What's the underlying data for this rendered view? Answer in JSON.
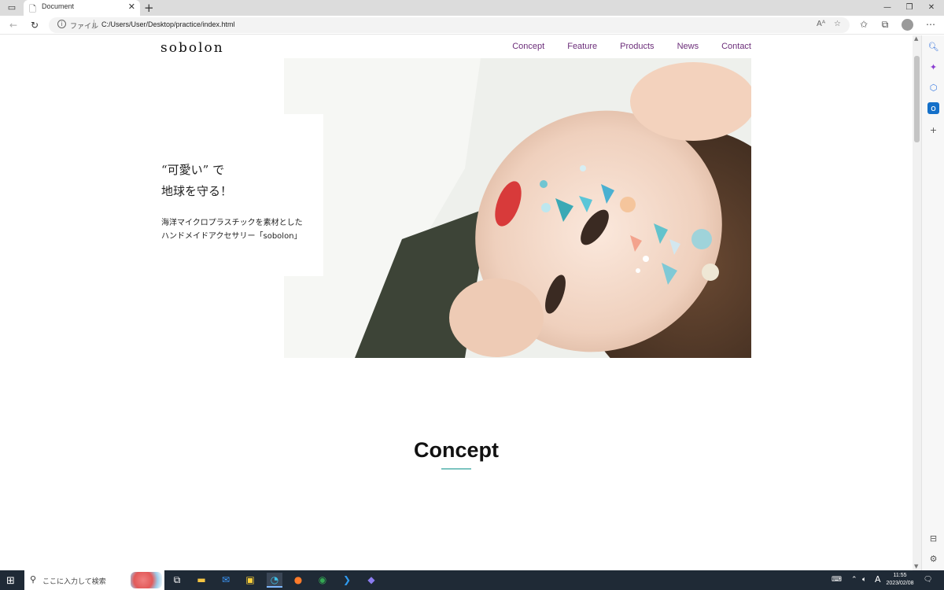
{
  "browser": {
    "tab_title": "Document",
    "address_scheme": "ファイル",
    "address_url": "C:/Users/User/Desktop/practice/index.html"
  },
  "site": {
    "logo": "sobolon",
    "nav": [
      "Concept",
      "Feature",
      "Products",
      "News",
      "Contact"
    ],
    "hero": {
      "title_lines": [
        "“可愛い” で",
        "地球を守る！"
      ],
      "sub_lines": [
        "海洋マイクロプラスチックを素材とした",
        "ハンドメイドアクセサリー「sobolon」"
      ]
    },
    "concept_heading": "Concept",
    "accent_color": "#7cc4c0",
    "nav_color": "#6c2e7a"
  },
  "taskbar": {
    "search_placeholder": "ここに入力して検索",
    "time": "11:55",
    "date": "2023/02/08",
    "ime": "A"
  }
}
